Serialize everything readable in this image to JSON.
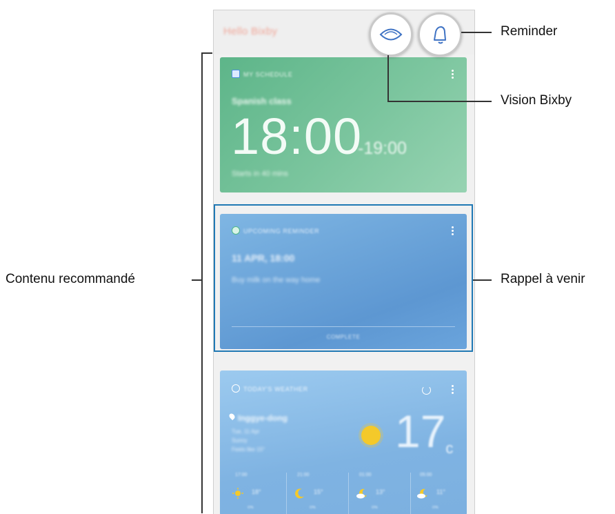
{
  "labels": {
    "reminder": "Reminder",
    "vision": "Vision Bixby",
    "recommended": "Contenu recommandé",
    "upcoming": "Rappel à venir"
  },
  "app": {
    "greeting": "Hello Bixby"
  },
  "cards": {
    "schedule": {
      "title": "MY SCHEDULE",
      "subject": "Spanish class",
      "start": "18:00",
      "end": "-19:00",
      "starts_in": "Starts in 40 mins"
    },
    "reminder": {
      "title": "UPCOMING REMINDER",
      "datetime": "11 APR, 18:00",
      "text": "Buy milk on the way home",
      "action": "COMPLETE"
    },
    "weather": {
      "title": "TODAY'S WEATHER",
      "location": "Inggye-dong",
      "line1": "Tue, 11 Apr",
      "line2": "Sunny",
      "line3": "Feels like 15°",
      "temp": "17",
      "unit": "c",
      "forecast": [
        {
          "time": "17:00",
          "temp": "18°",
          "prob": "0%",
          "icon": "sun-icon"
        },
        {
          "time": "21:00",
          "temp": "15°",
          "prob": "0%",
          "icon": "moon-icon"
        },
        {
          "time": "01:00",
          "temp": "13°",
          "prob": "0%",
          "icon": "moon-cloud-icon"
        },
        {
          "time": "05:00",
          "temp": "11°",
          "prob": "0%",
          "icon": "moon-cloud-icon"
        }
      ]
    }
  }
}
